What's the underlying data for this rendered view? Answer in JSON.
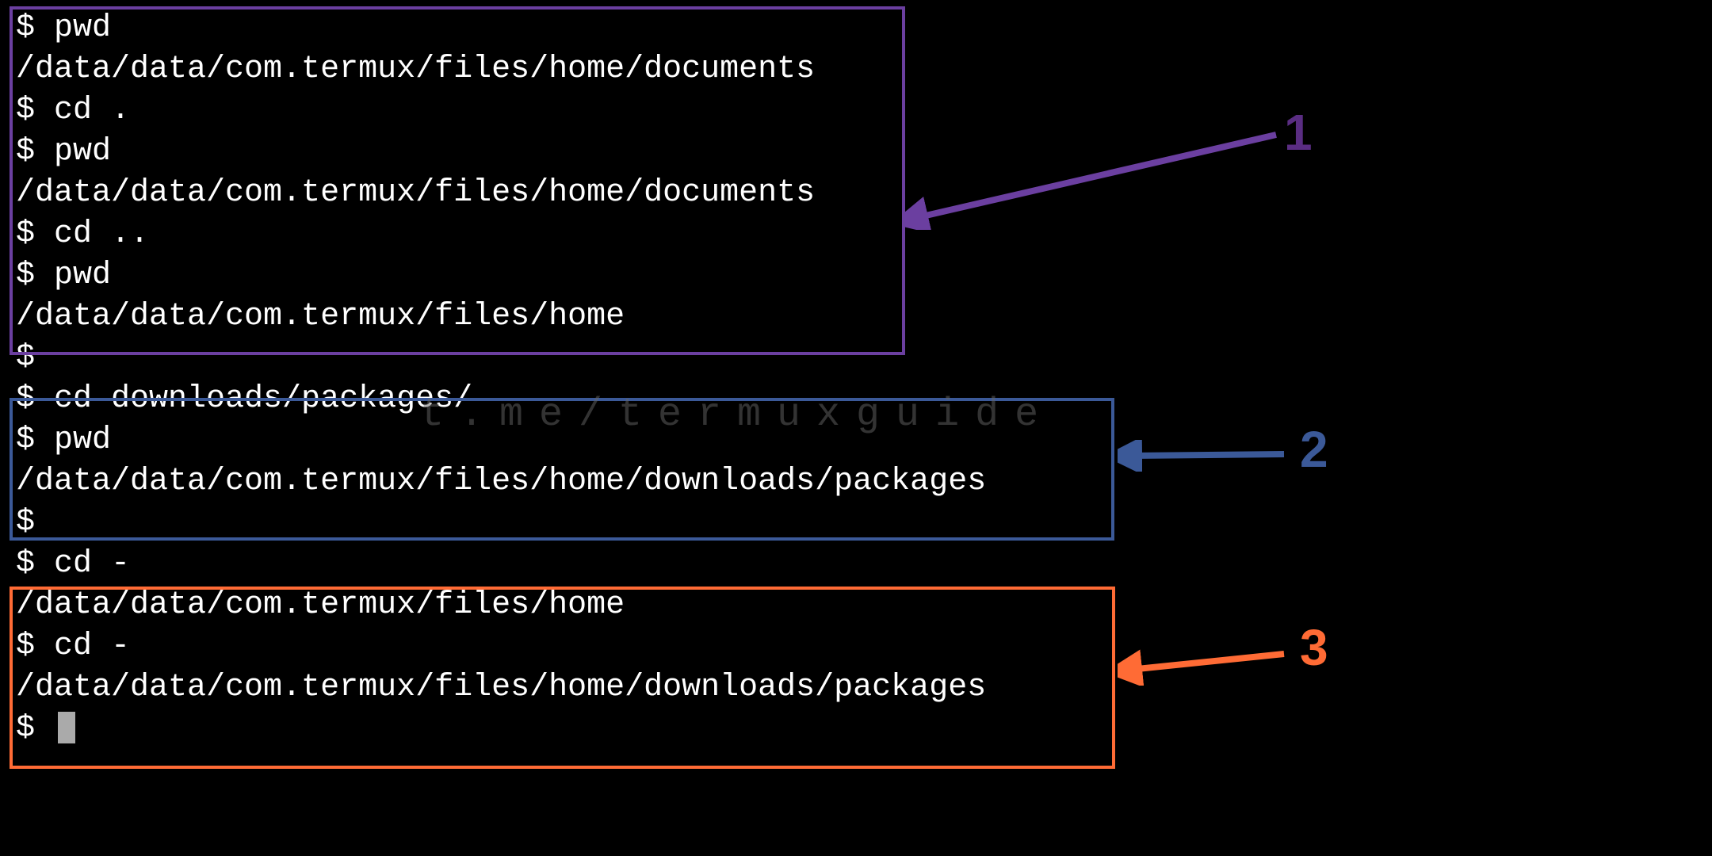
{
  "terminal": {
    "lines": [
      "$ pwd",
      "/data/data/com.termux/files/home/documents",
      "$ cd .",
      "$ pwd",
      "/data/data/com.termux/files/home/documents",
      "$ cd ..",
      "$ pwd",
      "/data/data/com.termux/files/home",
      "$",
      "$ cd downloads/packages/",
      "$ pwd",
      "/data/data/com.termux/files/home/downloads/packages",
      "$",
      "$ cd -",
      "/data/data/com.termux/files/home",
      "$ cd -",
      "/data/data/com.termux/files/home/downloads/packages",
      "$ "
    ]
  },
  "annotations": {
    "label1": "1",
    "label2": "2",
    "label3": "3"
  },
  "watermark": "t.me/termuxguide",
  "colors": {
    "box1": "#6b3fa0",
    "box2": "#3b5998",
    "box3": "#ff6b35"
  }
}
